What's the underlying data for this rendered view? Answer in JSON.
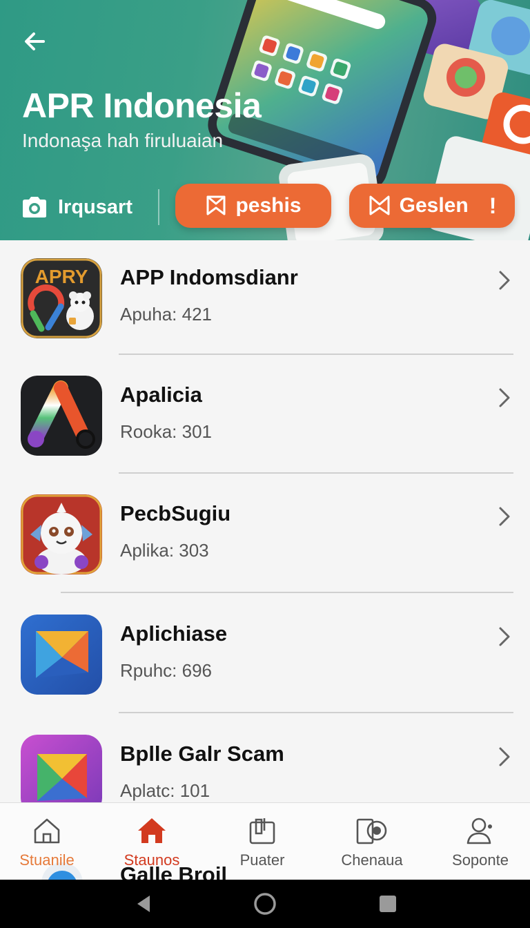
{
  "header": {
    "title": "APR Indonesia",
    "subtitle": "Indonaşa hah firuluaian",
    "back_icon": "arrow-left-icon",
    "actions": {
      "instant": {
        "label": "Irqusart",
        "icon": "camera-icon"
      },
      "pill_1": {
        "label": "peshis",
        "icon": "bookmark-icon"
      },
      "pill_2": {
        "label": "Geslen",
        "icon": "bookmark-icon",
        "badge": "!"
      }
    }
  },
  "apps": [
    {
      "name": "APP Indomsdianr",
      "meta": "Apuha: 421",
      "icon_text": "APRY"
    },
    {
      "name": "Apalicia",
      "meta": "Rooka: 301"
    },
    {
      "name": "PecbSugiu",
      "meta": "Aplika: 303"
    },
    {
      "name": "Aplichiase",
      "meta": "Rpuhc: 696"
    },
    {
      "name": "Bplle Galr Scam",
      "meta": "Aplatc: 101"
    }
  ],
  "bottom_nav": {
    "items": [
      {
        "label": "Stuanile",
        "icon": "home-outline-icon",
        "active": false
      },
      {
        "label": "Staunos",
        "icon": "home-filled-icon",
        "active": true
      },
      {
        "label": "Puater",
        "icon": "folder-icon",
        "active": false
      },
      {
        "label": "Chenaua",
        "icon": "camera-lens-icon",
        "active": false
      },
      {
        "label": "Soponte",
        "icon": "person-icon",
        "active": false
      }
    ],
    "peek_text": "Galle Broil"
  },
  "system_bar": {
    "back_icon": "nav-back-icon",
    "home_icon": "nav-home-icon",
    "recents_icon": "nav-recents-icon"
  },
  "colors": {
    "accent": "#EC6A35",
    "hero": "#2F9A85",
    "active_nav": "#D23A1F"
  }
}
